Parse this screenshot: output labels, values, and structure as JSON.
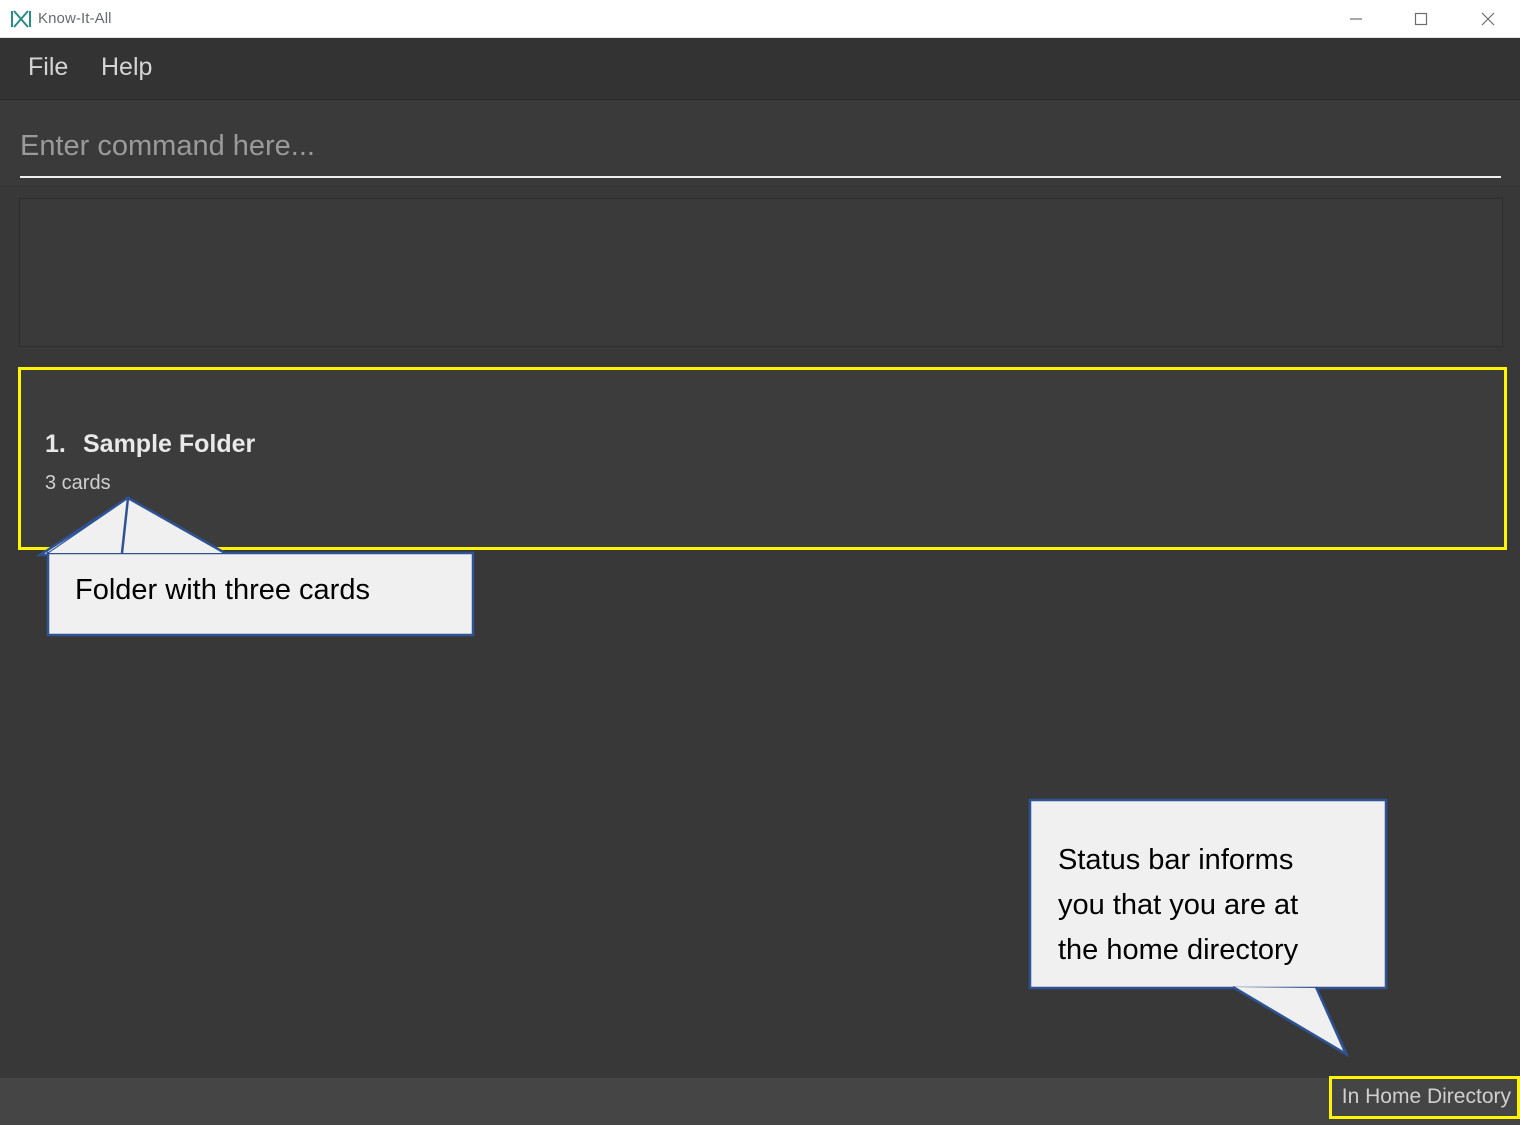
{
  "window": {
    "title": "Know-It-All",
    "app_icon": "kia-logo-icon",
    "controls": {
      "minimize": "minimize-icon",
      "maximize": "maximize-icon",
      "close": "close-icon"
    }
  },
  "menubar": {
    "items": [
      {
        "label": "File"
      },
      {
        "label": "Help"
      }
    ]
  },
  "command": {
    "value": "",
    "placeholder": "Enter command here..."
  },
  "result": {
    "text": ""
  },
  "folders": {
    "items": [
      {
        "index": "1.",
        "name": "Sample Folder",
        "subtitle": "3 cards"
      }
    ]
  },
  "statusbar": {
    "text": "In Home Directory"
  },
  "annotations": [
    {
      "id": "folder-callout",
      "text": "Folder with three cards"
    },
    {
      "id": "statusbar-callout",
      "text": "Status bar informs\nyou that you are at\nthe home directory"
    }
  ],
  "colors": {
    "window_chrome": "#ffffff",
    "app_background": "#383838",
    "menu_background": "#333333",
    "panel_background": "#3a3a3a",
    "list_background": "#3c3c3c",
    "statusbar_background": "#454545",
    "highlight": "#fff500",
    "callout_border": "#2e5395",
    "callout_fill": "#f0f0f0",
    "accent_logo": "#2a8c86"
  }
}
